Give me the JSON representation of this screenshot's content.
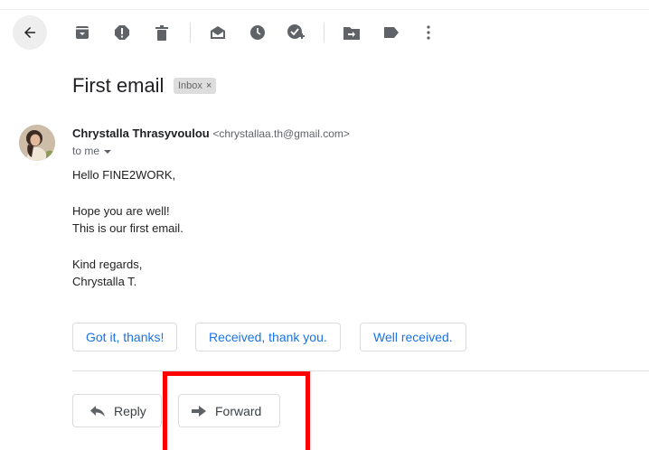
{
  "email": {
    "subject": "First email",
    "label_chip": "Inbox",
    "label_remove": "×",
    "sender_name": "Chrystalla Thrasyvoulou",
    "sender_email": "<chrystallaa.th@gmail.com>",
    "recipient": "to me",
    "body_lines": [
      "Hello FINE2WORK,",
      "Hope you are well!",
      "This is our first email.",
      "Kind regards,",
      "Chrystalla T."
    ]
  },
  "smart_replies": [
    "Got it, thanks!",
    "Received, thank you.",
    "Well received."
  ],
  "actions": {
    "reply": "Reply",
    "forward": "Forward"
  },
  "icons": {
    "back": "arrow-left-icon",
    "archive": "archive-icon",
    "spam": "report-spam-icon",
    "delete": "trash-icon",
    "mark_unread": "mark-unread-icon",
    "snooze": "clock-icon",
    "add_task": "add-task-icon",
    "move": "move-to-icon",
    "labels": "label-icon",
    "more": "more-vert-icon"
  },
  "colors": {
    "link_blue": "#1a73e8",
    "icon_gray": "#5f6368",
    "highlight": "#ff0000"
  }
}
